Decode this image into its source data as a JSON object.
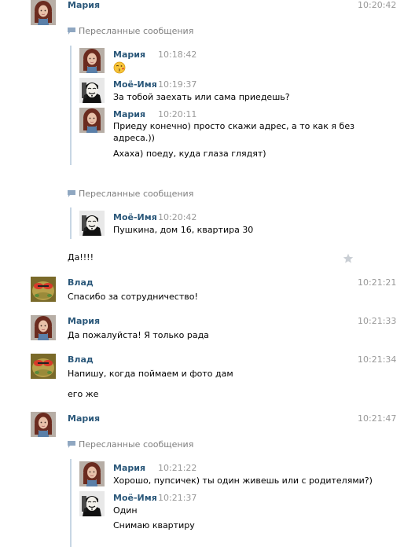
{
  "forwarded_label": "Пересланные сообщения",
  "msg1": {
    "name": "Мария",
    "time": "10:20:42",
    "fwd": [
      {
        "name": "Мария",
        "time": "10:18:42",
        "emoji": "kiss-emoji"
      },
      {
        "name": "Моё-Имя",
        "time": "10:19:37",
        "text": "За тобой заехать или сама приедешь?"
      },
      {
        "name": "Мария",
        "time": "10:20:11",
        "text1": "Приеду конечно) просто скажи адрес, а то как я без",
        "text2": "адреса.))",
        "text3": "Ахаха) поеду, куда глаза глядят)"
      }
    ]
  },
  "msg2": {
    "fwd": [
      {
        "name": "Моё-Имя",
        "time": "10:20:42",
        "text": "Пушкина, дом 16, квартира 30"
      }
    ],
    "text": "Да!!!!"
  },
  "msg3": {
    "name": "Влад",
    "time": "10:21:21",
    "text": "Спасибо за сотрудничество!"
  },
  "msg4": {
    "name": "Мария",
    "time": "10:21:33",
    "text": "Да пожалуйста! Я только рада"
  },
  "msg5": {
    "name": "Влад",
    "time": "10:21:34",
    "text": "Напишу, когда поймаем и фото дам",
    "text2": "его же"
  },
  "msg6": {
    "name": "Мария",
    "time": "10:21:47",
    "fwd": [
      {
        "name": "Мария",
        "time": "10:21:22",
        "text": "Хорошо, пупсичек) ты один живешь или с родителями?)"
      },
      {
        "name": "Моё-Имя",
        "time": "10:21:37",
        "text": "Один",
        "text2": "Снимаю квартиру"
      }
    ]
  },
  "colors": {
    "name": "#2b587a",
    "time": "#999999",
    "quote_bar": "#c7d6e4",
    "forward_label": "#7f7f7f"
  }
}
